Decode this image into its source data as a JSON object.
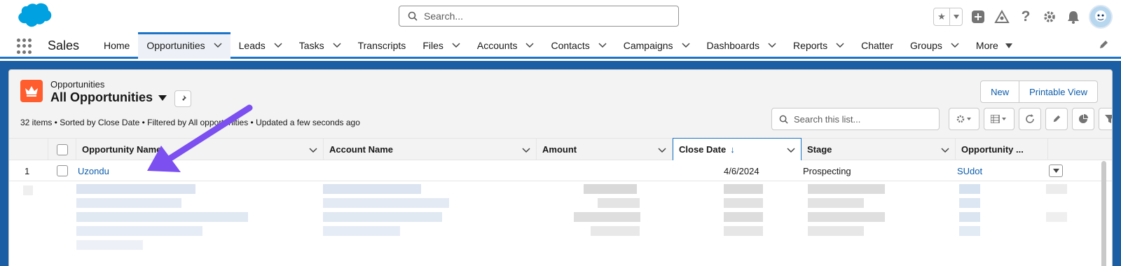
{
  "global": {
    "search_placeholder": "Search...",
    "logo": "salesforce-cloud-logo",
    "icons": [
      "favorites-star-icon",
      "add-icon",
      "trailhead-icon",
      "help-icon",
      "setup-gear-icon",
      "notifications-bell-icon",
      "user-avatar"
    ]
  },
  "nav": {
    "app_name": "Sales",
    "tabs": [
      {
        "label": "Home",
        "has_menu": false
      },
      {
        "label": "Opportunities",
        "has_menu": true,
        "active": true
      },
      {
        "label": "Leads",
        "has_menu": true
      },
      {
        "label": "Tasks",
        "has_menu": true
      },
      {
        "label": "Transcripts",
        "has_menu": false
      },
      {
        "label": "Files",
        "has_menu": true
      },
      {
        "label": "Accounts",
        "has_menu": true
      },
      {
        "label": "Contacts",
        "has_menu": true
      },
      {
        "label": "Campaigns",
        "has_menu": true
      },
      {
        "label": "Dashboards",
        "has_menu": true
      },
      {
        "label": "Reports",
        "has_menu": true
      },
      {
        "label": "Chatter",
        "has_menu": false
      },
      {
        "label": "Groups",
        "has_menu": true
      },
      {
        "label": "More",
        "has_menu": true
      }
    ]
  },
  "list": {
    "object_label": "Opportunities",
    "view_name": "All Opportunities",
    "meta": "32 items • Sorted by Close Date • Filtered by All opportunities • Updated a few seconds ago",
    "buttons": {
      "new": "New",
      "printable": "Printable View"
    },
    "search_placeholder": "Search this list...",
    "columns": [
      {
        "label": "Opportunity Name"
      },
      {
        "label": "Account Name"
      },
      {
        "label": "Amount"
      },
      {
        "label": "Close Date",
        "sorted": "ascending"
      },
      {
        "label": "Stage"
      },
      {
        "label": "Opportunity ..."
      }
    ],
    "rows": [
      {
        "num": "1",
        "name": "Uzondu",
        "account": "",
        "amount": "",
        "close_date": "4/6/2024",
        "stage": "Prospecting",
        "owner": "SUdot"
      }
    ]
  },
  "colors": {
    "brand_blue": "#1b74c6",
    "link": "#0b5cab",
    "object_icon": "#ff5d2d",
    "annotation_arrow": "#7b4ff0"
  }
}
